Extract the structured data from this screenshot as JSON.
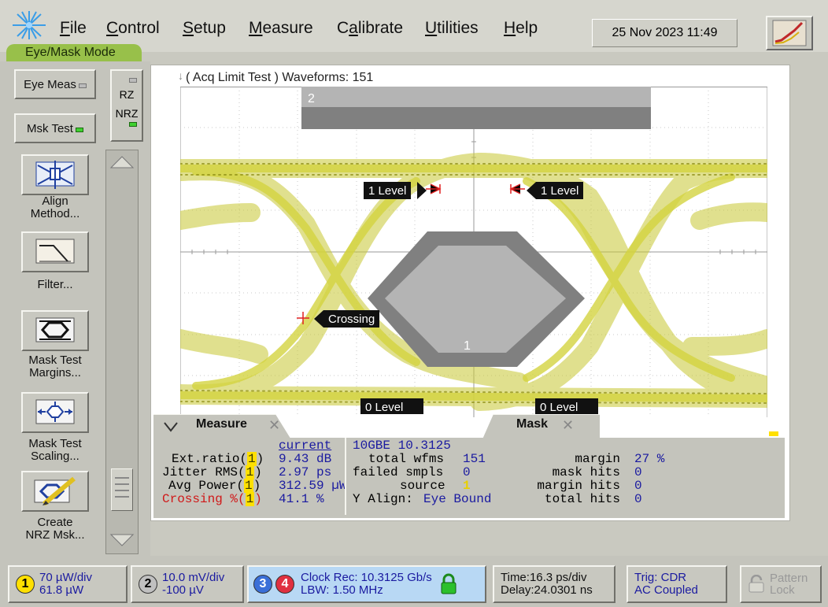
{
  "menubar": {
    "items": [
      {
        "label": "File",
        "u": "F",
        "rest": "ile"
      },
      {
        "label": "Control",
        "u": "C",
        "rest": "ontrol"
      },
      {
        "label": "Setup",
        "u": "S",
        "rest": "etup"
      },
      {
        "label": "Measure",
        "u": "M",
        "rest": "easure"
      },
      {
        "label": "Calibrate",
        "pre": "C",
        "u": "a",
        "rest": "librate"
      },
      {
        "label": "Utilities",
        "u": "U",
        "rest": "tilities"
      },
      {
        "label": "Help",
        "u": "H",
        "rest": "elp"
      }
    ],
    "datetime": "25 Nov 2023   11:49"
  },
  "mode_tab": "Eye/Mask Mode",
  "left_panel": {
    "eye_meas": "Eye Meas",
    "msk_test": "Msk Test",
    "rz": "RZ",
    "nrz": "NRZ",
    "tools": [
      {
        "label1": "Align",
        "label2": "Method...",
        "icon": "align-icon"
      },
      {
        "label1": "Filter...",
        "label2": "",
        "icon": "filter-icon"
      },
      {
        "label1": "Mask Test",
        "label2": "Margins...",
        "icon": "mask-margins-icon"
      },
      {
        "label1": "Mask Test",
        "label2": "Scaling...",
        "icon": "mask-scaling-icon"
      },
      {
        "label1": "Create",
        "label2": "NRZ Msk...",
        "icon": "create-mask-icon"
      }
    ]
  },
  "waveform": {
    "title": "( Acq Limit Test )  Waveforms: 151",
    "mask_region_2": "2",
    "mask_region_1": "1",
    "markers": {
      "one_level_left": "1 Level",
      "one_level_right": "1 Level",
      "crossing": "Crossing",
      "zero_level_left": "0 Level",
      "zero_level_right": "0 Level"
    }
  },
  "measure": {
    "tab": "Measure",
    "col_header": "current",
    "rows": [
      {
        "name": "Ext.ratio(",
        "ch": "1",
        "value": "9.43 dB"
      },
      {
        "name": "Jitter RMS(",
        "ch": "1",
        "value": "2.97 ps"
      },
      {
        "name": "Avg Power(",
        "ch": "1",
        "value": "312.59 µW"
      },
      {
        "name": "Crossing %(",
        "ch": "1",
        "value": "41.1 %"
      }
    ]
  },
  "mask": {
    "tab": "Mask",
    "standard": "10GBE 10.3125",
    "total_wfms_label": "total wfms",
    "total_wfms": "151",
    "failed_smpls_label": "failed smpls",
    "failed_smpls": "0",
    "source_label": "source",
    "source": "1",
    "yalign_label": "Y Align:",
    "yalign": "Eye Bound",
    "margin_label": "margin",
    "margin": "27 %",
    "mask_hits_label": "mask hits",
    "mask_hits": "0",
    "margin_hits_label": "margin hits",
    "margin_hits": "0",
    "total_hits_label": "total hits",
    "total_hits": "0"
  },
  "status": {
    "ch1": {
      "num": "1",
      "line1": "70 µW/div",
      "line2": "61.8 µW"
    },
    "ch2": {
      "num": "2",
      "line1": "10.0 mV/div",
      "line2": "-100 µV"
    },
    "ch3": "3",
    "ch4": "4",
    "clock_line1": "Clock Rec: 10.3125 Gb/s",
    "clock_line2": "LBW: 1.50 MHz",
    "time_line1": "Time:16.3 ps/div",
    "time_line2": "Delay:24.0301 ns",
    "trig_line1": "Trig: CDR",
    "trig_line2": "AC Coupled",
    "pattern_line1": "Pattern",
    "pattern_line2": "Lock"
  },
  "colors": {
    "eye": "#c8c832",
    "mask_dark": "#808080",
    "mask_light": "#b4b4b4",
    "ch1": "#ffe000",
    "ch2": "#b0b0b0",
    "ch3": "#3a6fd8",
    "ch4": "#e03040"
  }
}
